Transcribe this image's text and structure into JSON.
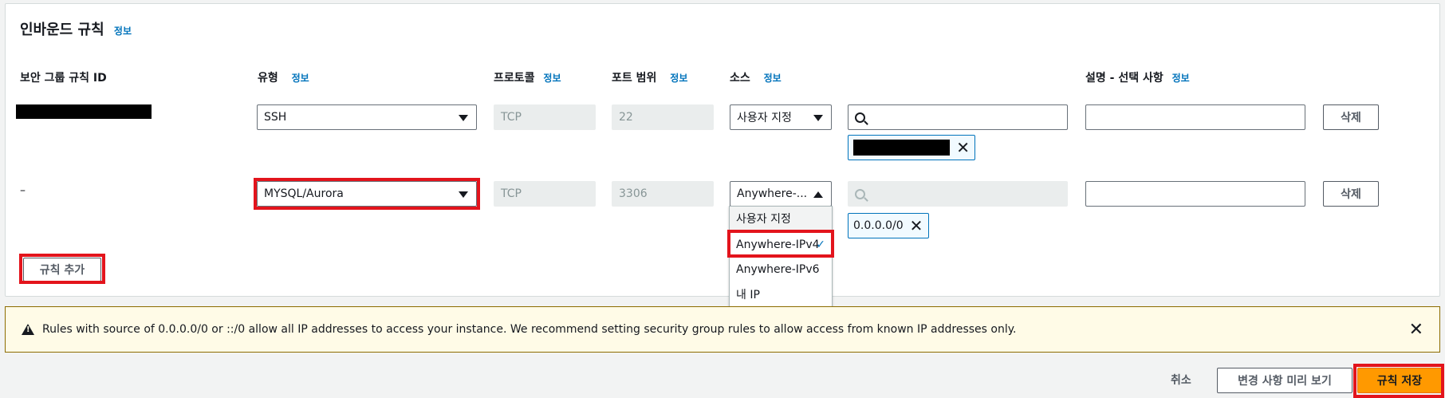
{
  "section": {
    "title": "인바운드 규칙",
    "info": "정보"
  },
  "columns": {
    "rule_id": "보안 그룹 규칙 ID",
    "type": "유형",
    "type_info": "정보",
    "protocol": "프로토콜",
    "protocol_info": "정보",
    "port": "포트 범위",
    "port_info": "정보",
    "source": "소스",
    "source_info": "정보",
    "description": "설명 - 선택 사항",
    "description_info": "정보"
  },
  "rules": [
    {
      "id": "",
      "type": "SSH",
      "protocol": "TCP",
      "port": "22",
      "source": "사용자 지정",
      "search_value": "",
      "token": "",
      "description": "",
      "delete": "삭제"
    },
    {
      "id": "–",
      "type": "MYSQL/Aurora",
      "protocol": "TCP",
      "port": "3306",
      "source": "Anywhere-...",
      "search_value": "",
      "token": "0.0.0.0/0",
      "description": "",
      "delete": "삭제"
    }
  ],
  "source_options": [
    "사용자 지정",
    "Anywhere-IPv4",
    "Anywhere-IPv6",
    "내 IP"
  ],
  "selected_source": "Anywhere-IPv4",
  "add_rule": "규칙 추가",
  "alert": "Rules with source of 0.0.0.0/0 or ::/0 allow all IP addresses to access your instance. We recommend setting security group rules to allow access from known IP addresses only.",
  "footer": {
    "cancel": "취소",
    "preview": "변경 사항 미리 보기",
    "save": "규칙 저장"
  },
  "colors": {
    "primary": "#ff9900",
    "link": "#0073bb",
    "highlight": "#e3141c",
    "alert_bg": "#fffbe7"
  }
}
